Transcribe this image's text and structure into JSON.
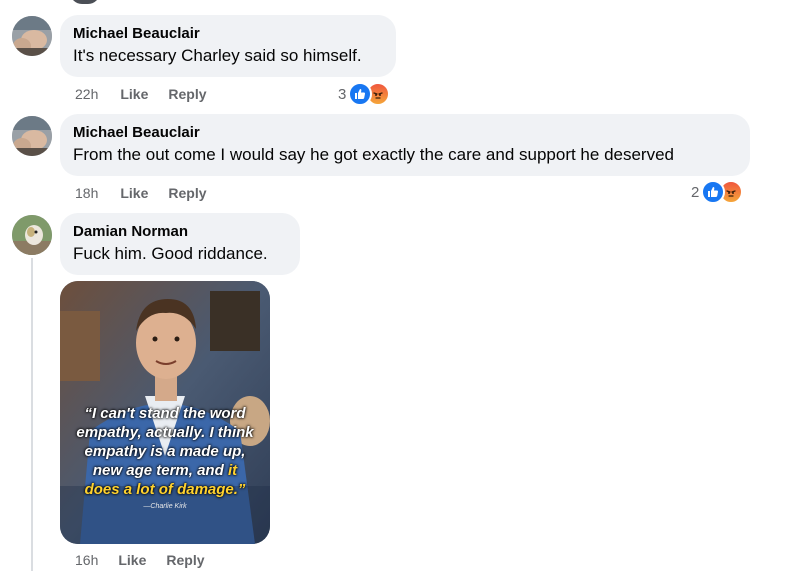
{
  "comments": [
    {
      "author": "Michael Beauclair",
      "text": "It's necessary Charley said so himself.",
      "time": "22h",
      "like_label": "Like",
      "reply_label": "Reply",
      "reaction_count": "3"
    },
    {
      "author": "Michael Beauclair",
      "text": "From the out come I would say he got exactly the care and support he deserved",
      "time": "18h",
      "like_label": "Like",
      "reply_label": "Reply",
      "reaction_count": "2"
    },
    {
      "author": "Damian Norman",
      "text": "Fuck him. Good riddance.",
      "time": "16h",
      "like_label": "Like",
      "reply_label": "Reply",
      "image": {
        "quote_line1": "“I can't stand the word",
        "quote_line2": "empathy, actually. I think",
        "quote_line3": "empathy is a made up,",
        "quote_line4": "new age term, and",
        "quote_line4_highlight": "it",
        "quote_line5": "does a lot of damage.”",
        "credit": "—Charlie Kirk"
      }
    }
  ],
  "reaction_icons": [
    "like-icon",
    "angry-icon"
  ],
  "colors": {
    "bubble": "#f0f2f5",
    "meta_text": "#65676b",
    "like_blue": "#1877f2",
    "quote_yellow": "#ffd22e"
  }
}
